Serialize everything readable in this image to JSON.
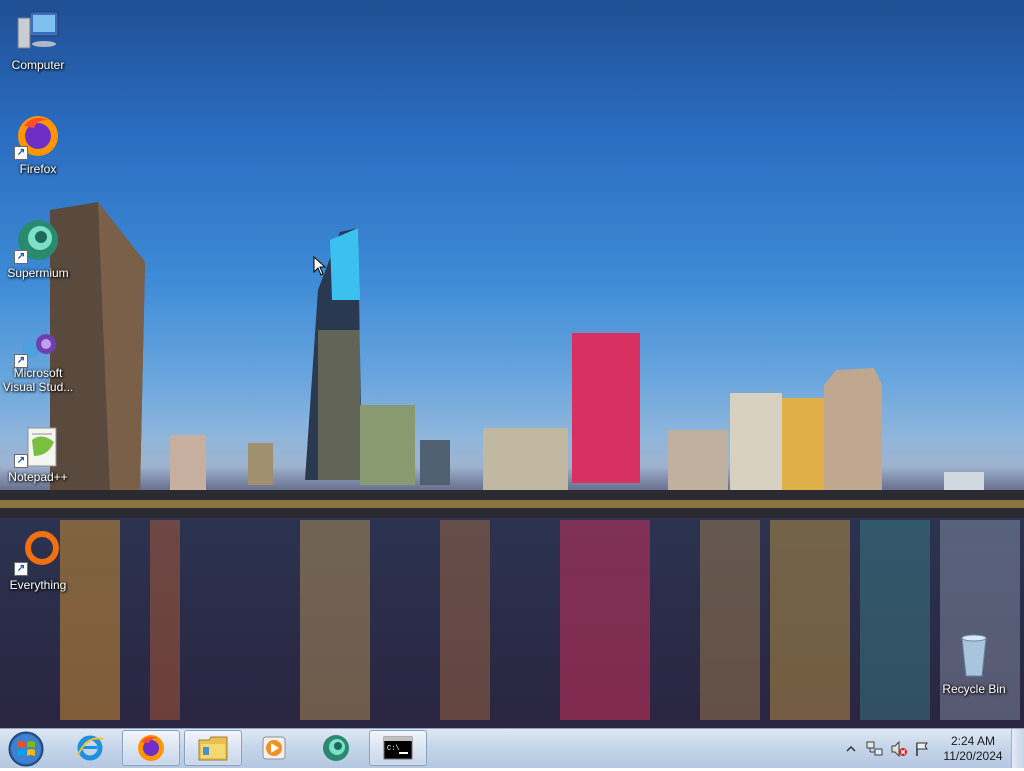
{
  "desktop": {
    "icons": [
      {
        "label": "Computer"
      },
      {
        "label": "Firefox"
      },
      {
        "label": "Supermium"
      },
      {
        "label": "Microsoft Visual Stud..."
      },
      {
        "label": "Notepad++"
      },
      {
        "label": "Everything"
      },
      {
        "label": "Recycle Bin"
      }
    ]
  },
  "taskbar": {
    "start_icon": "windows-start-orb",
    "items": [
      {
        "icon": "internet-explorer-icon"
      },
      {
        "icon": "firefox-icon",
        "active": true
      },
      {
        "icon": "file-explorer-icon",
        "active": true
      },
      {
        "icon": "media-player-icon"
      },
      {
        "icon": "supermium-icon"
      },
      {
        "icon": "command-prompt-icon",
        "active": true
      }
    ],
    "clock": {
      "time": "2:24 AM",
      "date": "11/20/2024"
    }
  },
  "colors": {
    "taskbar": "#c6d6ea",
    "sky_top": "#1f4f94",
    "sky_bottom": "#8fb6dc"
  }
}
